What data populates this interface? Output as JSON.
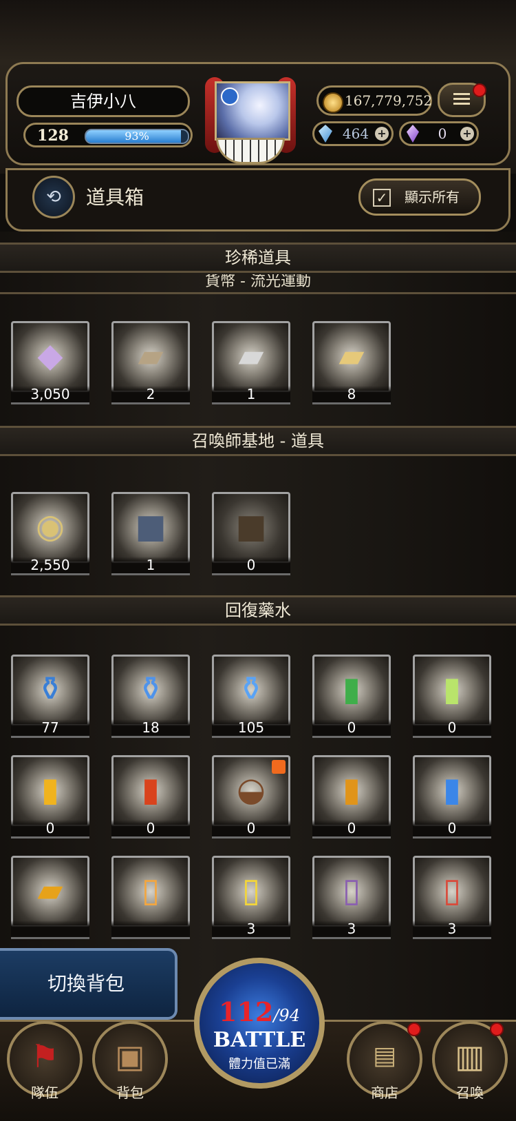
{
  "player": {
    "name": "吉伊小八",
    "level": "128",
    "exp_percent": "93%",
    "exp_fraction": 0.93
  },
  "currency": {
    "gold": "167,779,752",
    "gems": "464",
    "crystals": "0"
  },
  "header": {
    "title": "道具箱",
    "show_all_label": "顯示所有"
  },
  "sections": [
    {
      "title": "珍稀道具",
      "subtitle": "貨幣 - 流光運動",
      "items": [
        {
          "icon": "crystal-icon",
          "count": "3,050"
        },
        {
          "icon": "bronze-card-icon",
          "count": "2"
        },
        {
          "icon": "silver-card-icon",
          "count": "1"
        },
        {
          "icon": "gold-card-icon",
          "count": "8"
        }
      ]
    },
    {
      "title": "召喚師基地 - 道具",
      "items": [
        {
          "icon": "medal-icon",
          "count": "2,550"
        },
        {
          "icon": "backpack-icon",
          "count": "1"
        },
        {
          "icon": "dark-backpack-icon",
          "count": "0"
        }
      ]
    },
    {
      "title": "回復藥水",
      "items": [
        {
          "icon": "potion-small-icon",
          "count": "77"
        },
        {
          "icon": "potion-medium-icon",
          "count": "18"
        },
        {
          "icon": "potion-large-icon",
          "count": "105"
        },
        {
          "icon": "green-bottle-icon",
          "count": "0"
        },
        {
          "icon": "lime-bottle-icon",
          "count": "0"
        },
        {
          "icon": "yellow-bottle-icon",
          "count": "0"
        },
        {
          "icon": "red-bottle-icon",
          "count": "0"
        },
        {
          "icon": "beef-bowl-icon",
          "count": "0"
        },
        {
          "icon": "tea-bottle-icon",
          "count": "0"
        },
        {
          "icon": "water-bottle-icon",
          "count": "0"
        },
        {
          "icon": "chips-bag-icon",
          "count": ""
        },
        {
          "icon": "honey-tea-carton-icon",
          "count": ""
        },
        {
          "icon": "yuzu-tea-carton-icon",
          "count": "3"
        },
        {
          "icon": "fruit-tea-carton-icon",
          "count": "3"
        },
        {
          "icon": "apple-tea-carton-icon",
          "count": "3"
        }
      ]
    }
  ],
  "switch_bag_label": "切換背包",
  "battle": {
    "stamina_current": "112",
    "stamina_max": "/94",
    "label": "BATTLE",
    "status": "體力值已滿"
  },
  "nav": {
    "team": "隊伍",
    "bag": "背包",
    "shop": "商店",
    "summon": "召喚"
  },
  "colors": {
    "frame_gold": "#8e7a52",
    "exp_blue": "#2a7fd0",
    "stamina_red": "#e8232a",
    "notification_red": "#e01c1c"
  }
}
